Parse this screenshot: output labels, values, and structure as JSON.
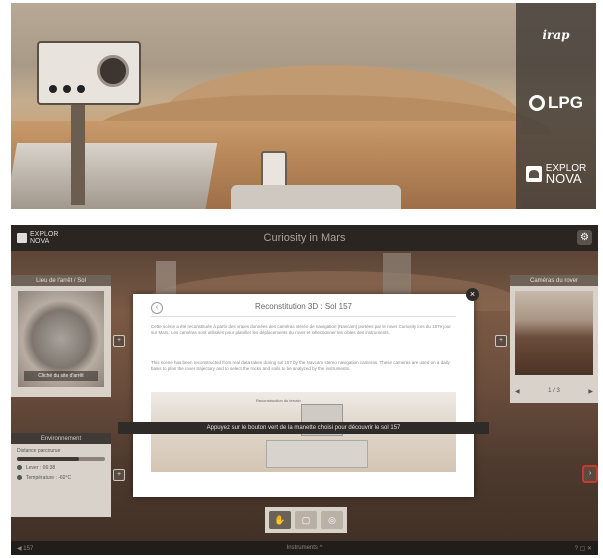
{
  "hero": {
    "logos": {
      "irap": "irap",
      "lpg": "LPG",
      "explor_line1": "EXPLOR",
      "explor_line2": "NOVA"
    }
  },
  "app": {
    "header": {
      "logo_line1": "EXPLOR",
      "logo_line2": "NOVA",
      "title": "Curiosity in Mars",
      "settings_icon": "gear-icon"
    },
    "left_panel": {
      "title": "Lieu de l'arrêt / Sol",
      "photo_caption": "Cliché du site d'arrêt",
      "expand_label": "+"
    },
    "environment_panel": {
      "title": "Environnement",
      "row1": "Distance parcourue",
      "progress": 0.7,
      "row2": "Lever : 06:38",
      "row3": "Température : -60°C",
      "expand_label": "+"
    },
    "right_panel": {
      "title": "Caméras du rover",
      "pager_prev": "◀",
      "pager_text": "1 / 3",
      "pager_next": "▶",
      "expand_label": "+",
      "edge_label": "›"
    },
    "modal": {
      "title": "Reconstitution 3D : Sol 157",
      "back_label": "‹",
      "close_label": "×",
      "paragraph1": "Cette scène a été reconstituée à partir des vraies données des caméras stéréo de navigation (Navcam) portées par le rover Curiosity lors du 157e jour sur Mars. Les caméras sont utilisées pour planifier les déplacements du rover et sélectionner les cibles des instruments.",
      "paragraph2": "This scene has been reconstructed from real data taken during sol 157 by the Navcam stereo navigation cameras. These cameras are used on a daily basis to plan the rover trajectory and to select the rocks and soils to be analyzed by the instruments.",
      "figure_label": "Reconstruction du terrain",
      "banner": "Appuyez sur le bouton vert de la manette choisi pour découvrir le sol 157"
    },
    "toolbar": {
      "tool1": "✋",
      "tool2": "▢",
      "tool3": "◎"
    },
    "bottombar": {
      "left": "◀ 157",
      "center": "Instruments ^",
      "right": "? ▢ ✕"
    }
  }
}
